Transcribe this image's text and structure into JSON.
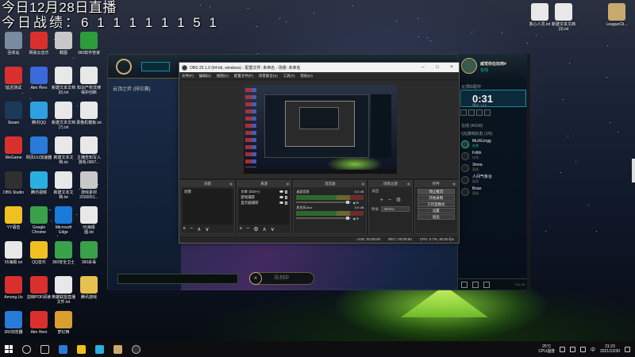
{
  "overlay": {
    "line1": "今日12月28日直播",
    "line2": "今日战绩：6 1 1 1 1 1 1 5 1"
  },
  "desktop_icons": [
    {
      "label": "回收站",
      "icon": "recycle-bin-icon",
      "color": "#7a8aa0"
    },
    {
      "label": "网易云音乐",
      "icon": "netease-music-icon",
      "color": "#d9302e"
    },
    {
      "label": "截图",
      "icon": "screenshot-icon",
      "color": "#c8c8c8"
    },
    {
      "label": "360软件管家",
      "icon": "360-manager-icon",
      "color": "#2d9c3c"
    },
    {
      "label": "延迟测试",
      "icon": "latency-test-icon",
      "color": "#d9302e"
    },
    {
      "label": "Aim Hero",
      "icon": "aim-hero-icon",
      "color": "#3a6ad9"
    },
    {
      "label": "新建文本文档\n(6).txt",
      "icon": "txt-file-icon",
      "color": "#e8e8e8"
    },
    {
      "label": "知识产权法律\n保护创新",
      "icon": "txt-file-icon",
      "color": "#e8e8e8"
    },
    {
      "label": "Steam",
      "icon": "steam-icon",
      "color": "#1b3a5a"
    },
    {
      "label": "腾讯QQ",
      "icon": "qq-icon",
      "color": "#2ea0e0"
    },
    {
      "label": "新建文本文档\n(7).txt",
      "icon": "txt-file-icon",
      "color": "#e8e8e8"
    },
    {
      "label": "录像机模板.txt",
      "icon": "txt-file-icon",
      "color": "#e8e8e8"
    },
    {
      "label": "WeGame",
      "icon": "wegame-icon",
      "color": "#d9302e"
    },
    {
      "label": "网页UU加速器",
      "icon": "uu-booster-icon",
      "color": "#2a7ad9"
    },
    {
      "label": "新建文本文\n档.txt",
      "icon": "txt-file-icon",
      "color": "#e8e8e8"
    },
    {
      "label": "主播告知写入\n游戏.0807...",
      "icon": "txt-file-icon",
      "color": "#e8e8e8"
    },
    {
      "label": "OBS Studio",
      "icon": "obs-icon",
      "color": "#303030"
    },
    {
      "label": "腾讯视频",
      "icon": "tencent-video-icon",
      "color": "#2ab0e0"
    },
    {
      "label": "新建文本文\n档.txt",
      "icon": "txt-file-icon",
      "color": "#e8e8e8"
    },
    {
      "label": "游戏素材\n2020051...",
      "icon": "image-file-icon",
      "color": "#c8c8c8"
    },
    {
      "label": "YY语音",
      "icon": "yy-icon",
      "color": "#f0c020"
    },
    {
      "label": "Google\nChrome",
      "icon": "chrome-icon",
      "color": "#3aa04a"
    },
    {
      "label": "Microsoft\nEdge",
      "icon": "edge-icon",
      "color": "#1a7ad9"
    },
    {
      "label": "55海报\n图.txt",
      "icon": "txt-file-icon",
      "color": "#e8e8e8"
    },
    {
      "label": "55海报.txt",
      "icon": "txt-file-icon",
      "color": "#e8e8e8"
    },
    {
      "label": "QQ音乐",
      "icon": "qq-music-icon",
      "color": "#f0c020"
    },
    {
      "label": "360安全卫士",
      "icon": "360-security-icon",
      "color": "#3aa04a"
    },
    {
      "label": "360杀毒",
      "icon": "360-antivirus-icon",
      "color": "#3aa04a"
    },
    {
      "label": "Among Us",
      "icon": "among-us-icon",
      "color": "#d9302e"
    },
    {
      "label": "剪映PDF阅读",
      "icon": "pdf-reader-icon",
      "color": "#d9302e"
    },
    {
      "label": "英雄联盟直播\n文件.txt",
      "icon": "txt-file-icon",
      "color": "#e8e8e8"
    },
    {
      "label": "腾讯游戏",
      "icon": "folder-icon",
      "color": "#e8c050"
    },
    {
      "label": "360浏览器",
      "icon": "360-browser-icon",
      "color": "#2a7ad9"
    },
    {
      "label": "Aim Hero",
      "icon": "aim-hero-icon",
      "color": "#d9302e"
    },
    {
      "label": "梦幻西",
      "icon": "game-icon",
      "color": "#d9a030"
    }
  ],
  "right_icons": [
    {
      "label": "答心人员.txt",
      "icon": "txt-file-icon"
    },
    {
      "label": "新建文本文档\n(3).txt",
      "icon": "txt-file-icon"
    },
    {
      "label": "LeagueCli...",
      "icon": "league-client-icon"
    }
  ],
  "lol": {
    "queue_title": "云顶之弈 (排位赛)",
    "find_match": "队列中",
    "social": {
      "name": "威觉你在玩西#",
      "status": "在线",
      "queue_label": "云顶匹配中",
      "timer": "0:31",
      "timer_sub": "预计: 1:10",
      "group1": "在线 (4/100)",
      "group2": "QQ游戏好友 (1/5)",
      "friends": [
        {
          "name": "MuXiLingg",
          "status": "在线",
          "online": true
        },
        {
          "name": "Fdbh",
          "status": "在线",
          "online": false
        },
        {
          "name": "3mea",
          "status": "离线",
          "online": false
        },
        {
          "name": "人间气象台",
          "status": "离线",
          "online": false
        },
        {
          "name": "Bxao",
          "status": "离线",
          "online": false
        }
      ],
      "version": "V11.25"
    }
  },
  "obs": {
    "title": "OBS 25.1.0 (64-bit, windows) - 配置文件: 未命名 - 场景: 未命名",
    "menu": [
      "文件(F)",
      "编辑(E)",
      "视图(V)",
      "配置文件(P)",
      "场景集合(S)",
      "工具(T)",
      "帮助(H)"
    ],
    "docks": {
      "scenes": {
        "title": "场景",
        "items": [
          "场景"
        ]
      },
      "sources": {
        "title": "来源",
        "items": [
          "文本 (GDI+)",
          "游戏捕获",
          "显示器捕获"
        ]
      },
      "mixer": {
        "title": "混音器",
        "channels": [
          {
            "name": "桌面音频",
            "db": "0.0 dB"
          },
          {
            "name": "麦克风/Aux",
            "db": "0.0 dB"
          }
        ]
      },
      "transitions": {
        "title": "场景过渡",
        "type": "淡出",
        "duration_label": "时长",
        "duration": "300ms"
      },
      "controls": {
        "title": "控件",
        "buttons": [
          "停止推流",
          "开始录制",
          "工作室模式",
          "设置",
          "退出"
        ]
      }
    },
    "status": {
      "live": "LIVE: 00:00:00",
      "rec": "REC: 00:00:00",
      "cpu": "CPU: 0.7%, 60.00 fps"
    }
  },
  "taskbar": {
    "weather_temp": "25°C",
    "weather_desc": "CPU温度",
    "time": "21:23",
    "date": "2021/12/30",
    "lang": "中"
  }
}
